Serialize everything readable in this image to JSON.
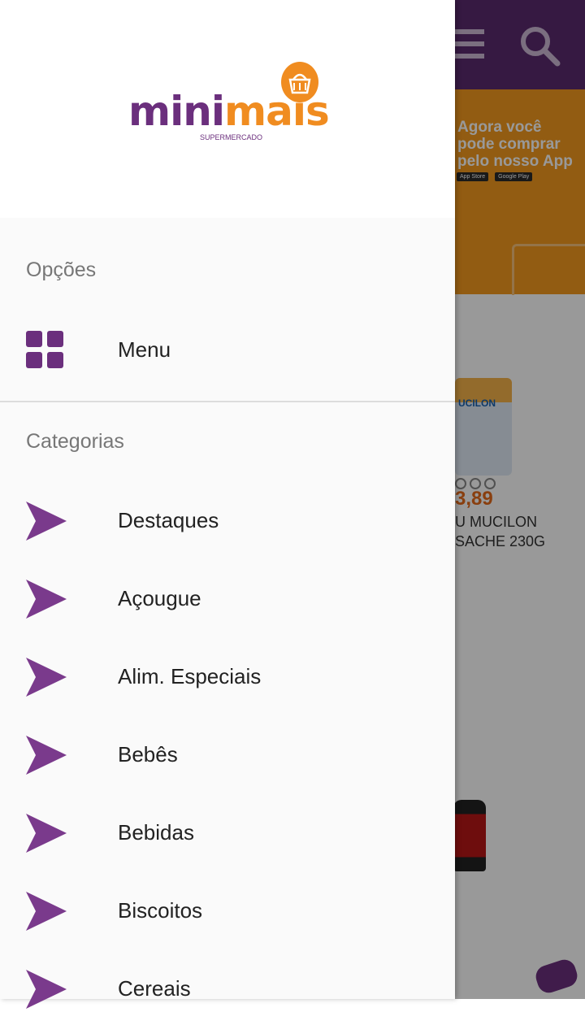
{
  "brand": {
    "purple": "#6b2f7d",
    "orange": "#f08c20",
    "logo_text_part1": "mini",
    "logo_text_part2": "mais",
    "logo_subtitle": "SUPERMERCADO"
  },
  "background": {
    "banner_text": "Agora você pode comprar pelo nosso App",
    "store_badge_1": "App Store",
    "store_badge_2": "Google Play",
    "product_brand": "UCILON",
    "product_price": "3,89",
    "product_name": "U MUCILON SACHE 230G"
  },
  "drawer": {
    "options_heading": "Opções",
    "menu_item": {
      "label": "Menu",
      "icon": "grid-icon"
    },
    "categories_heading": "Categorias",
    "categories": [
      {
        "label": "Destaques",
        "icon": "arrow-right-icon"
      },
      {
        "label": "Açougue",
        "icon": "arrow-right-icon"
      },
      {
        "label": "Alim. Especiais",
        "icon": "arrow-right-icon"
      },
      {
        "label": "Bebês",
        "icon": "arrow-right-icon"
      },
      {
        "label": "Bebidas",
        "icon": "arrow-right-icon"
      },
      {
        "label": "Biscoitos",
        "icon": "arrow-right-icon"
      },
      {
        "label": "Cereais",
        "icon": "arrow-right-icon"
      }
    ]
  }
}
